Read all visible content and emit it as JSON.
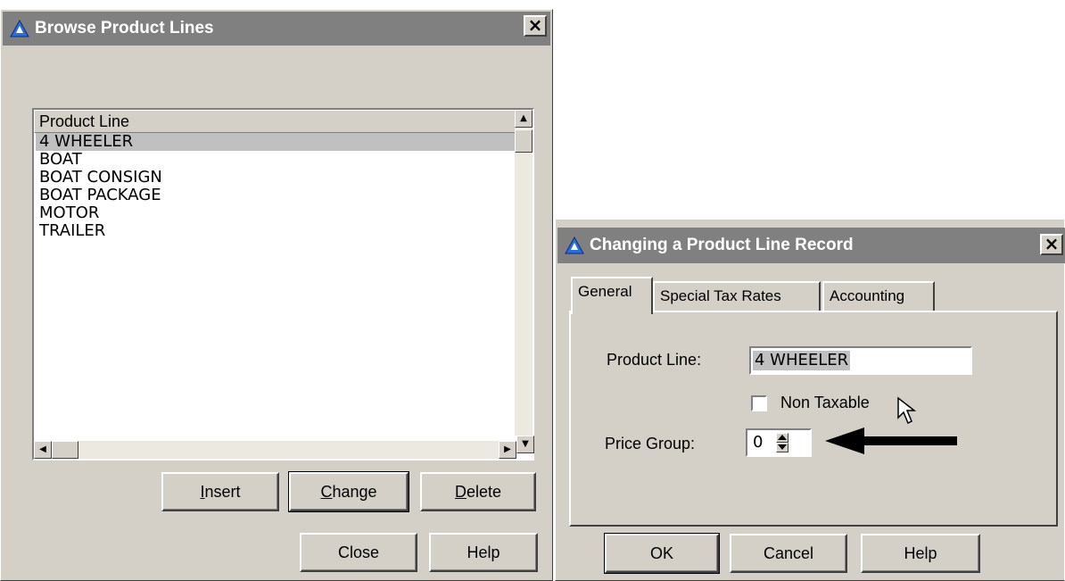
{
  "browse": {
    "title": "Browse Product Lines",
    "close_glyph": "×",
    "list_header": "Product Line",
    "items": [
      "4 WHEELER",
      "BOAT",
      "BOAT CONSIGN",
      "BOAT PACKAGE",
      "MOTOR",
      "TRAILER"
    ],
    "selected_index": 0,
    "buttons": {
      "insert": {
        "mnemonic": "I",
        "rest": "nsert"
      },
      "change": {
        "mnemonic": "C",
        "rest": "hange"
      },
      "delete": {
        "mnemonic": "D",
        "rest": "elete"
      },
      "close": "Close",
      "help": "Help"
    }
  },
  "change": {
    "title": "Changing a Product Line  Record",
    "close_glyph": "×",
    "tabs": [
      "General",
      "Special Tax Rates",
      "Accounting"
    ],
    "active_tab": "General",
    "product_line_label": "Product Line:",
    "product_line_value": "4 WHEELER",
    "non_taxable_label": "Non Taxable",
    "non_taxable_checked": false,
    "price_group_label": "Price Group:",
    "price_group_value": "0",
    "buttons": {
      "ok": "OK",
      "cancel": "Cancel",
      "help": "Help"
    }
  },
  "icons": {
    "app_icon": "app-triangle-icon",
    "arrow": "arrow-left-icon",
    "cursor": "mouse-pointer-icon"
  },
  "colors": {
    "window_face": "#d4d0c8",
    "inactive_titlebar": "#808080",
    "selection": "#c0c0c0"
  }
}
